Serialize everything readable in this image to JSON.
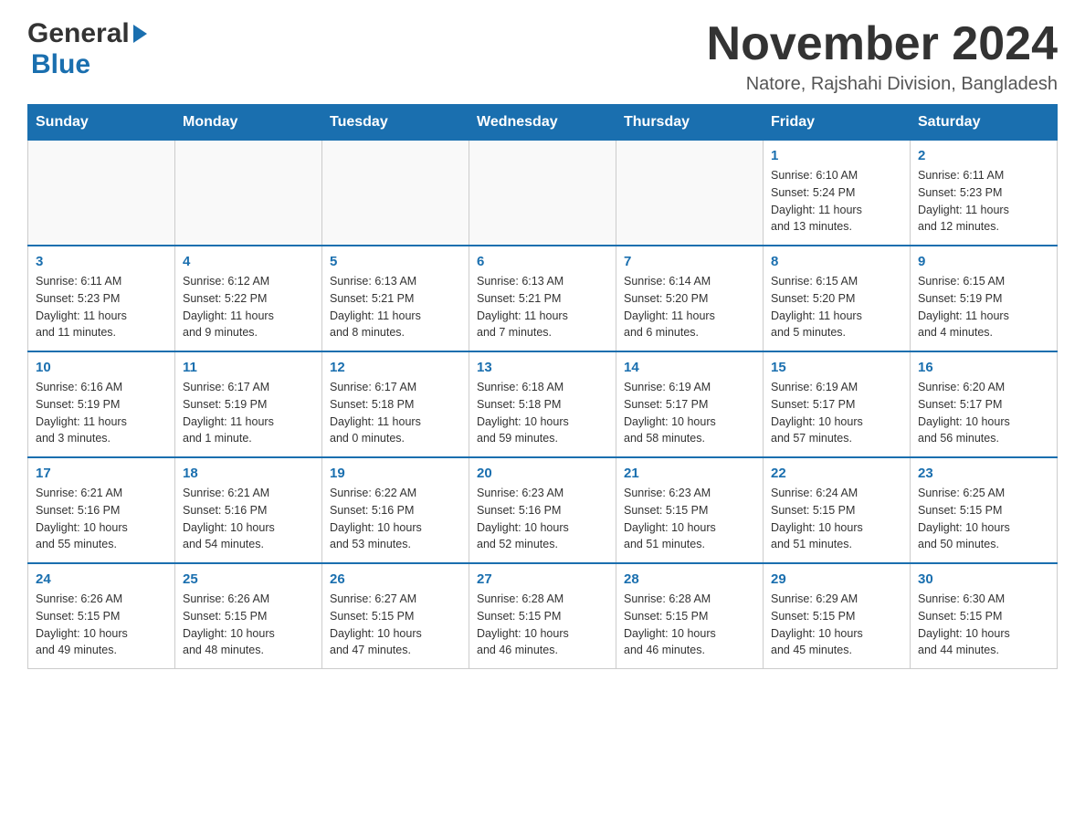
{
  "header": {
    "logo_general": "General",
    "logo_blue": "Blue",
    "month_title": "November 2024",
    "location": "Natore, Rajshahi Division, Bangladesh"
  },
  "weekdays": [
    "Sunday",
    "Monday",
    "Tuesday",
    "Wednesday",
    "Thursday",
    "Friday",
    "Saturday"
  ],
  "weeks": [
    [
      {
        "day": "",
        "info": ""
      },
      {
        "day": "",
        "info": ""
      },
      {
        "day": "",
        "info": ""
      },
      {
        "day": "",
        "info": ""
      },
      {
        "day": "",
        "info": ""
      },
      {
        "day": "1",
        "info": "Sunrise: 6:10 AM\nSunset: 5:24 PM\nDaylight: 11 hours\nand 13 minutes."
      },
      {
        "day": "2",
        "info": "Sunrise: 6:11 AM\nSunset: 5:23 PM\nDaylight: 11 hours\nand 12 minutes."
      }
    ],
    [
      {
        "day": "3",
        "info": "Sunrise: 6:11 AM\nSunset: 5:23 PM\nDaylight: 11 hours\nand 11 minutes."
      },
      {
        "day": "4",
        "info": "Sunrise: 6:12 AM\nSunset: 5:22 PM\nDaylight: 11 hours\nand 9 minutes."
      },
      {
        "day": "5",
        "info": "Sunrise: 6:13 AM\nSunset: 5:21 PM\nDaylight: 11 hours\nand 8 minutes."
      },
      {
        "day": "6",
        "info": "Sunrise: 6:13 AM\nSunset: 5:21 PM\nDaylight: 11 hours\nand 7 minutes."
      },
      {
        "day": "7",
        "info": "Sunrise: 6:14 AM\nSunset: 5:20 PM\nDaylight: 11 hours\nand 6 minutes."
      },
      {
        "day": "8",
        "info": "Sunrise: 6:15 AM\nSunset: 5:20 PM\nDaylight: 11 hours\nand 5 minutes."
      },
      {
        "day": "9",
        "info": "Sunrise: 6:15 AM\nSunset: 5:19 PM\nDaylight: 11 hours\nand 4 minutes."
      }
    ],
    [
      {
        "day": "10",
        "info": "Sunrise: 6:16 AM\nSunset: 5:19 PM\nDaylight: 11 hours\nand 3 minutes."
      },
      {
        "day": "11",
        "info": "Sunrise: 6:17 AM\nSunset: 5:19 PM\nDaylight: 11 hours\nand 1 minute."
      },
      {
        "day": "12",
        "info": "Sunrise: 6:17 AM\nSunset: 5:18 PM\nDaylight: 11 hours\nand 0 minutes."
      },
      {
        "day": "13",
        "info": "Sunrise: 6:18 AM\nSunset: 5:18 PM\nDaylight: 10 hours\nand 59 minutes."
      },
      {
        "day": "14",
        "info": "Sunrise: 6:19 AM\nSunset: 5:17 PM\nDaylight: 10 hours\nand 58 minutes."
      },
      {
        "day": "15",
        "info": "Sunrise: 6:19 AM\nSunset: 5:17 PM\nDaylight: 10 hours\nand 57 minutes."
      },
      {
        "day": "16",
        "info": "Sunrise: 6:20 AM\nSunset: 5:17 PM\nDaylight: 10 hours\nand 56 minutes."
      }
    ],
    [
      {
        "day": "17",
        "info": "Sunrise: 6:21 AM\nSunset: 5:16 PM\nDaylight: 10 hours\nand 55 minutes."
      },
      {
        "day": "18",
        "info": "Sunrise: 6:21 AM\nSunset: 5:16 PM\nDaylight: 10 hours\nand 54 minutes."
      },
      {
        "day": "19",
        "info": "Sunrise: 6:22 AM\nSunset: 5:16 PM\nDaylight: 10 hours\nand 53 minutes."
      },
      {
        "day": "20",
        "info": "Sunrise: 6:23 AM\nSunset: 5:16 PM\nDaylight: 10 hours\nand 52 minutes."
      },
      {
        "day": "21",
        "info": "Sunrise: 6:23 AM\nSunset: 5:15 PM\nDaylight: 10 hours\nand 51 minutes."
      },
      {
        "day": "22",
        "info": "Sunrise: 6:24 AM\nSunset: 5:15 PM\nDaylight: 10 hours\nand 51 minutes."
      },
      {
        "day": "23",
        "info": "Sunrise: 6:25 AM\nSunset: 5:15 PM\nDaylight: 10 hours\nand 50 minutes."
      }
    ],
    [
      {
        "day": "24",
        "info": "Sunrise: 6:26 AM\nSunset: 5:15 PM\nDaylight: 10 hours\nand 49 minutes."
      },
      {
        "day": "25",
        "info": "Sunrise: 6:26 AM\nSunset: 5:15 PM\nDaylight: 10 hours\nand 48 minutes."
      },
      {
        "day": "26",
        "info": "Sunrise: 6:27 AM\nSunset: 5:15 PM\nDaylight: 10 hours\nand 47 minutes."
      },
      {
        "day": "27",
        "info": "Sunrise: 6:28 AM\nSunset: 5:15 PM\nDaylight: 10 hours\nand 46 minutes."
      },
      {
        "day": "28",
        "info": "Sunrise: 6:28 AM\nSunset: 5:15 PM\nDaylight: 10 hours\nand 46 minutes."
      },
      {
        "day": "29",
        "info": "Sunrise: 6:29 AM\nSunset: 5:15 PM\nDaylight: 10 hours\nand 45 minutes."
      },
      {
        "day": "30",
        "info": "Sunrise: 6:30 AM\nSunset: 5:15 PM\nDaylight: 10 hours\nand 44 minutes."
      }
    ]
  ]
}
